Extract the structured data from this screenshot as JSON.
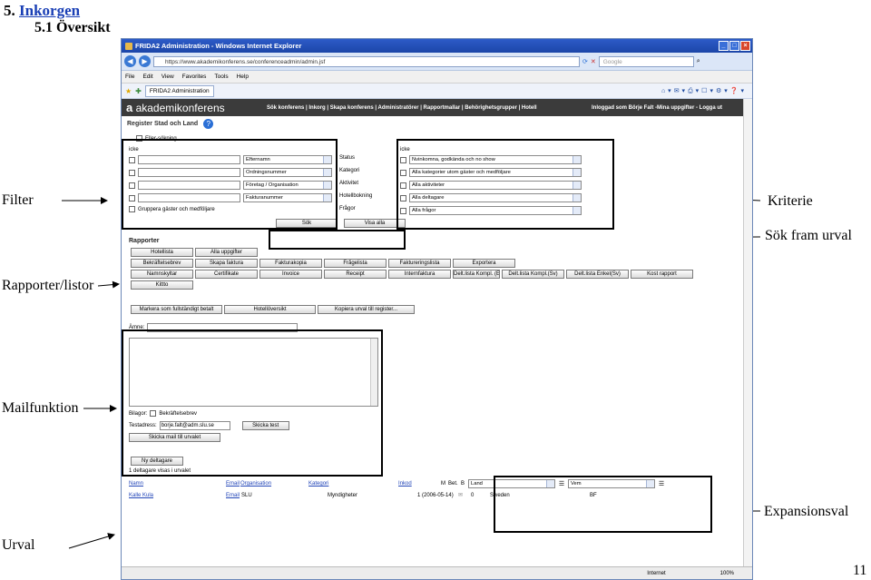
{
  "doc": {
    "heading_num": "5.",
    "heading_link": "Inkorgen",
    "subheading": "5.1 Översikt",
    "page_number": "11"
  },
  "annotations": {
    "filter": "Filter",
    "kriterie": "Kriterie",
    "sok_fram_urval": "Sök fram urval",
    "rapporter_listor": "Rapporter/listor",
    "mailfunktion": "Mailfunktion",
    "expansionsval": "Expansionsval",
    "urval": "Urval"
  },
  "browser": {
    "title": "FRIDA2 Administration - Windows Internet Explorer",
    "address": "https://www.akademikonferens.se/conferenceadmin/admin.jsf",
    "search_placeholder": "Google",
    "menu": [
      "File",
      "Edit",
      "View",
      "Favorites",
      "Tools",
      "Help"
    ],
    "tab": "FRIDA2 Administration",
    "status_zone": "Internet",
    "status_zoom": "100%"
  },
  "site": {
    "logo_prefix": "a",
    "logo_name": "akademikonferens",
    "nav": "Sök konferens | Inkorg | Skapa konferens | Administratörer | Rapportmallar | Behörighetsgrupper | Hotell",
    "logged_in": "Inloggad som Börje Falt -Mina uppgifter - Logga ut"
  },
  "register": {
    "title": "Register Stad och Land",
    "eller_sokning": "Eller-sökning",
    "icke": "icke",
    "icke2": "icke",
    "filter_fields": [
      "Efternamn",
      "Ordningsnummer",
      "Företag / Organisation",
      "Fakturanummer"
    ],
    "gruppera": "Gruppera gäster och medföljare",
    "criteria_labels": [
      "Status",
      "Kategori",
      "Aktivitet",
      "Hotellbokning",
      "Frågor"
    ],
    "criteria_values": [
      "Nvinkomna, godkända och no show",
      "Alla kategorier utom gäster och medföljare",
      "Alla aktiviteter",
      "Alla deltagare",
      "Alla frågor"
    ],
    "sok_button": "Sök",
    "visa_alla_button": "Visa alla"
  },
  "rapporter": {
    "title": "Rapporter",
    "row1": [
      "Hotellista",
      "Alla uppgifter"
    ],
    "row2": [
      "Bekräftelsebrev",
      "Skapa faktura",
      "Fakturakopia",
      "Frågelista",
      "Faktureringslista",
      "Exportera"
    ],
    "row3": [
      "Namnskyltar",
      "Certifikate",
      "Invoice",
      "Receipt",
      "Internfaktura",
      "Delt.lista Kompl. (Eng)",
      "Delt.lista Kompl.(Sv)",
      "Delt.lista Enkel(Sv)",
      "Kost rapport"
    ],
    "row4": [
      "Kittto"
    ]
  },
  "actions": [
    "Markera som fullständigt betalt",
    "Hotellöversikt",
    "Kopiera urval till register..."
  ],
  "mail": {
    "amne_label": "Ämne:",
    "bilagor_label": "Bilagor:",
    "bilaga": "Bekräftelsebrev",
    "testadress_label": "Testadress:",
    "testadress_value": "borje.falt@adm.slu.se",
    "skicka_test": "Skicka test",
    "skicka_mail": "Skicka mail till urvalet"
  },
  "urval": {
    "ny_deltagare": "Ny deltagare",
    "count_text": "1 deltagare visas i urvalet",
    "columns": [
      "Namn",
      "Email",
      "Organisation",
      "Kategori",
      "Inkod",
      "M",
      "Bet.",
      "B"
    ],
    "row": {
      "namn": "Kalle Kula",
      "email": "Email",
      "organisation": "SLU",
      "kategori": "Myndigheter",
      "inkod": "1 (2006-05-14)",
      "b": "0",
      "land": "Sweden",
      "vem": "BF"
    },
    "expansion_select1": "Land",
    "expansion_select2": "Vem"
  }
}
